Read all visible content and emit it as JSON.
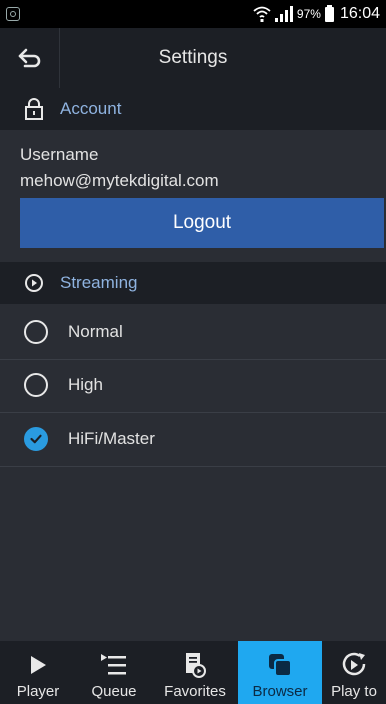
{
  "status_bar": {
    "battery_percent": "97%",
    "time": "16:04"
  },
  "header": {
    "title": "Settings"
  },
  "account": {
    "section_title": "Account",
    "username_label": "Username",
    "username_value": "mehow@mytekdigital.com",
    "logout_label": "Logout"
  },
  "streaming": {
    "section_title": "Streaming",
    "options": [
      {
        "label": "Normal",
        "selected": false
      },
      {
        "label": "High",
        "selected": false
      },
      {
        "label": "HiFi/Master",
        "selected": true
      }
    ]
  },
  "bottom_nav": {
    "items": [
      {
        "label": "Player",
        "icon": "play-icon"
      },
      {
        "label": "Queue",
        "icon": "queue-icon"
      },
      {
        "label": "Favorites",
        "icon": "favorites-icon"
      },
      {
        "label": "Browser",
        "icon": "browser-icon",
        "active": true
      },
      {
        "label": "Play to",
        "icon": "play-to-icon"
      }
    ]
  },
  "colors": {
    "accent": "#1fa8f0",
    "button": "#2f5ea8",
    "section_text": "#8fb3e0",
    "background": "#2a2d34"
  }
}
